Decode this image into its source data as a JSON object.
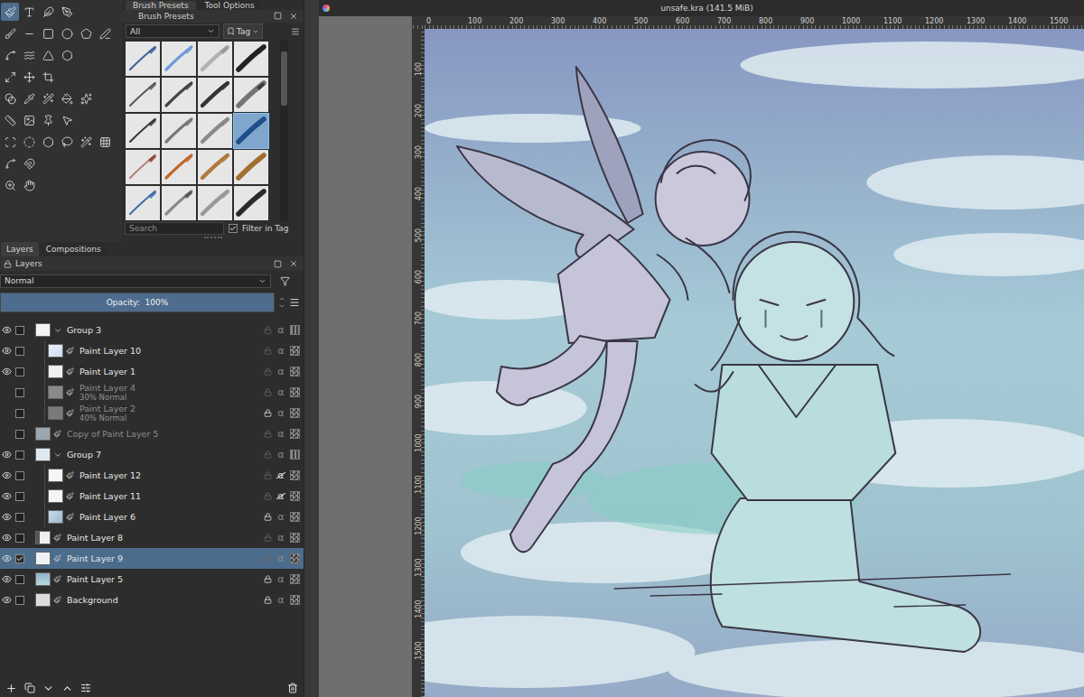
{
  "window": {
    "title": "unsafe.kra (141.5 MiB)"
  },
  "toolbox": {
    "tool_rows": [
      [
        {
          "selected": true
        },
        {
          "selected": false
        },
        {
          "selected": false
        },
        {
          "selected": false
        }
      ],
      [
        {
          "selected": false
        },
        {
          "selected": false
        },
        {
          "selected": false
        },
        {
          "selected": false
        },
        {
          "selected": false
        },
        {
          "selected": false
        }
      ],
      [
        {
          "selected": false
        },
        {
          "selected": false
        },
        {
          "selected": false
        },
        {
          "selected": false
        }
      ],
      [
        {
          "selected": false
        },
        {
          "selected": false
        },
        {
          "selected": false
        }
      ],
      [
        {
          "selected": false
        },
        {
          "selected": false
        },
        {
          "selected": false
        },
        {
          "selected": false
        },
        {
          "selected": false
        }
      ],
      [
        {
          "selected": false
        },
        {
          "selected": false
        },
        {
          "selected": false
        },
        {
          "selected": false
        }
      ],
      [
        {
          "selected": false
        },
        {
          "selected": false
        },
        {
          "selected": false
        },
        {
          "selected": false
        },
        {
          "selected": false
        },
        {
          "selected": false
        }
      ],
      [
        {
          "selected": false
        },
        {
          "selected": false
        }
      ],
      [
        {
          "selected": false
        },
        {
          "selected": false
        }
      ]
    ]
  },
  "brush_docker": {
    "tabs": [
      {
        "label": "Brush Presets",
        "selected": true
      },
      {
        "label": "Tool Options",
        "selected": false
      }
    ],
    "title": "Brush Presets",
    "filter": "All",
    "tag_button": "Tag",
    "presets": [
      {
        "selected": false
      },
      {
        "selected": false
      },
      {
        "selected": false
      },
      {
        "selected": false
      },
      {
        "selected": false
      },
      {
        "selected": false
      },
      {
        "selected": false
      },
      {
        "selected": false
      },
      {
        "selected": false
      },
      {
        "selected": false
      },
      {
        "selected": false
      },
      {
        "selected": true
      },
      {
        "selected": false
      },
      {
        "selected": false
      },
      {
        "selected": false
      },
      {
        "selected": false
      },
      {
        "selected": false
      },
      {
        "selected": false
      },
      {
        "selected": false
      },
      {
        "selected": false
      }
    ],
    "search": {
      "placeholder": "Search"
    },
    "filter_in_tag": {
      "label": "Filter in Tag",
      "checked": true
    }
  },
  "layers_docker": {
    "tabs": [
      {
        "label": "Layers",
        "selected": true
      },
      {
        "label": "Compositions",
        "selected": false
      }
    ],
    "title": "Layers",
    "blend_mode": "Normal",
    "opacity": {
      "label": "Opacity:  100%",
      "level": 1
    },
    "alpha_symbol": "α",
    "layers": [
      {
        "name": "Group 3",
        "kind": "group",
        "depth": 0,
        "expanded": true,
        "visible": true,
        "checked": false,
        "locked": false,
        "alpha_inherit": false,
        "selected": false
      },
      {
        "name": "Paint Layer 10",
        "kind": "paint",
        "depth": 1,
        "visible": true,
        "checked": false,
        "locked": false,
        "alpha_inherit": false,
        "selected": false
      },
      {
        "name": "Paint Layer 1",
        "kind": "paint",
        "depth": 1,
        "visible": true,
        "checked": false,
        "locked": false,
        "alpha_inherit": false,
        "selected": false
      },
      {
        "name": "Paint Layer 4",
        "info": "30% Normal",
        "kind": "paint",
        "depth": 1,
        "visible": false,
        "checked": false,
        "locked": false,
        "alpha_inherit": false,
        "selected": false
      },
      {
        "name": "Paint Layer 2",
        "info": "40% Normal",
        "kind": "paint",
        "depth": 1,
        "visible": false,
        "checked": false,
        "locked": true,
        "alpha_inherit": false,
        "selected": false
      },
      {
        "name": "Copy of Paint Layer 5",
        "kind": "paint",
        "depth": 0,
        "visible": false,
        "checked": false,
        "locked": false,
        "alpha_inherit": false,
        "selected": false
      },
      {
        "name": "Group 7",
        "kind": "group",
        "depth": 0,
        "expanded": true,
        "visible": true,
        "checked": false,
        "locked": false,
        "alpha_inherit": false,
        "selected": false
      },
      {
        "name": "Paint Layer 12",
        "kind": "paint",
        "depth": 1,
        "visible": true,
        "checked": false,
        "locked": false,
        "alpha_inherit": true,
        "selected": false
      },
      {
        "name": "Paint Layer 11",
        "kind": "paint",
        "depth": 1,
        "visible": true,
        "checked": false,
        "locked": false,
        "alpha_inherit": true,
        "selected": false
      },
      {
        "name": "Paint Layer 6",
        "kind": "paint",
        "depth": 1,
        "visible": true,
        "checked": false,
        "locked": true,
        "alpha_inherit": false,
        "selected": false
      },
      {
        "name": "Paint Layer 8",
        "kind": "paint",
        "depth": 0,
        "visible": true,
        "checked": false,
        "locked": false,
        "alpha_inherit": false,
        "selected": false
      },
      {
        "name": "Paint Layer 9",
        "kind": "paint",
        "depth": 0,
        "visible": true,
        "checked": true,
        "locked": false,
        "alpha_inherit": false,
        "selected": true
      },
      {
        "name": "Paint Layer 5",
        "kind": "paint",
        "depth": 0,
        "visible": true,
        "checked": false,
        "locked": true,
        "alpha_inherit": false,
        "selected": false
      },
      {
        "name": "Background",
        "kind": "paint",
        "depth": 0,
        "visible": true,
        "checked": false,
        "locked": true,
        "alpha_inherit": false,
        "selected": false
      }
    ]
  },
  "rulers": {
    "horizontal": [
      "0",
      "100",
      "200",
      "300",
      "400",
      "500",
      "600",
      "700",
      "800",
      "900",
      "1000",
      "1100",
      "1200",
      "1300",
      "1400",
      "1500"
    ],
    "vertical": [
      "100",
      "200",
      "300",
      "400",
      "500",
      "600",
      "700",
      "800",
      "900",
      "1000",
      "1100",
      "1200",
      "1300",
      "1400",
      "1500"
    ]
  }
}
